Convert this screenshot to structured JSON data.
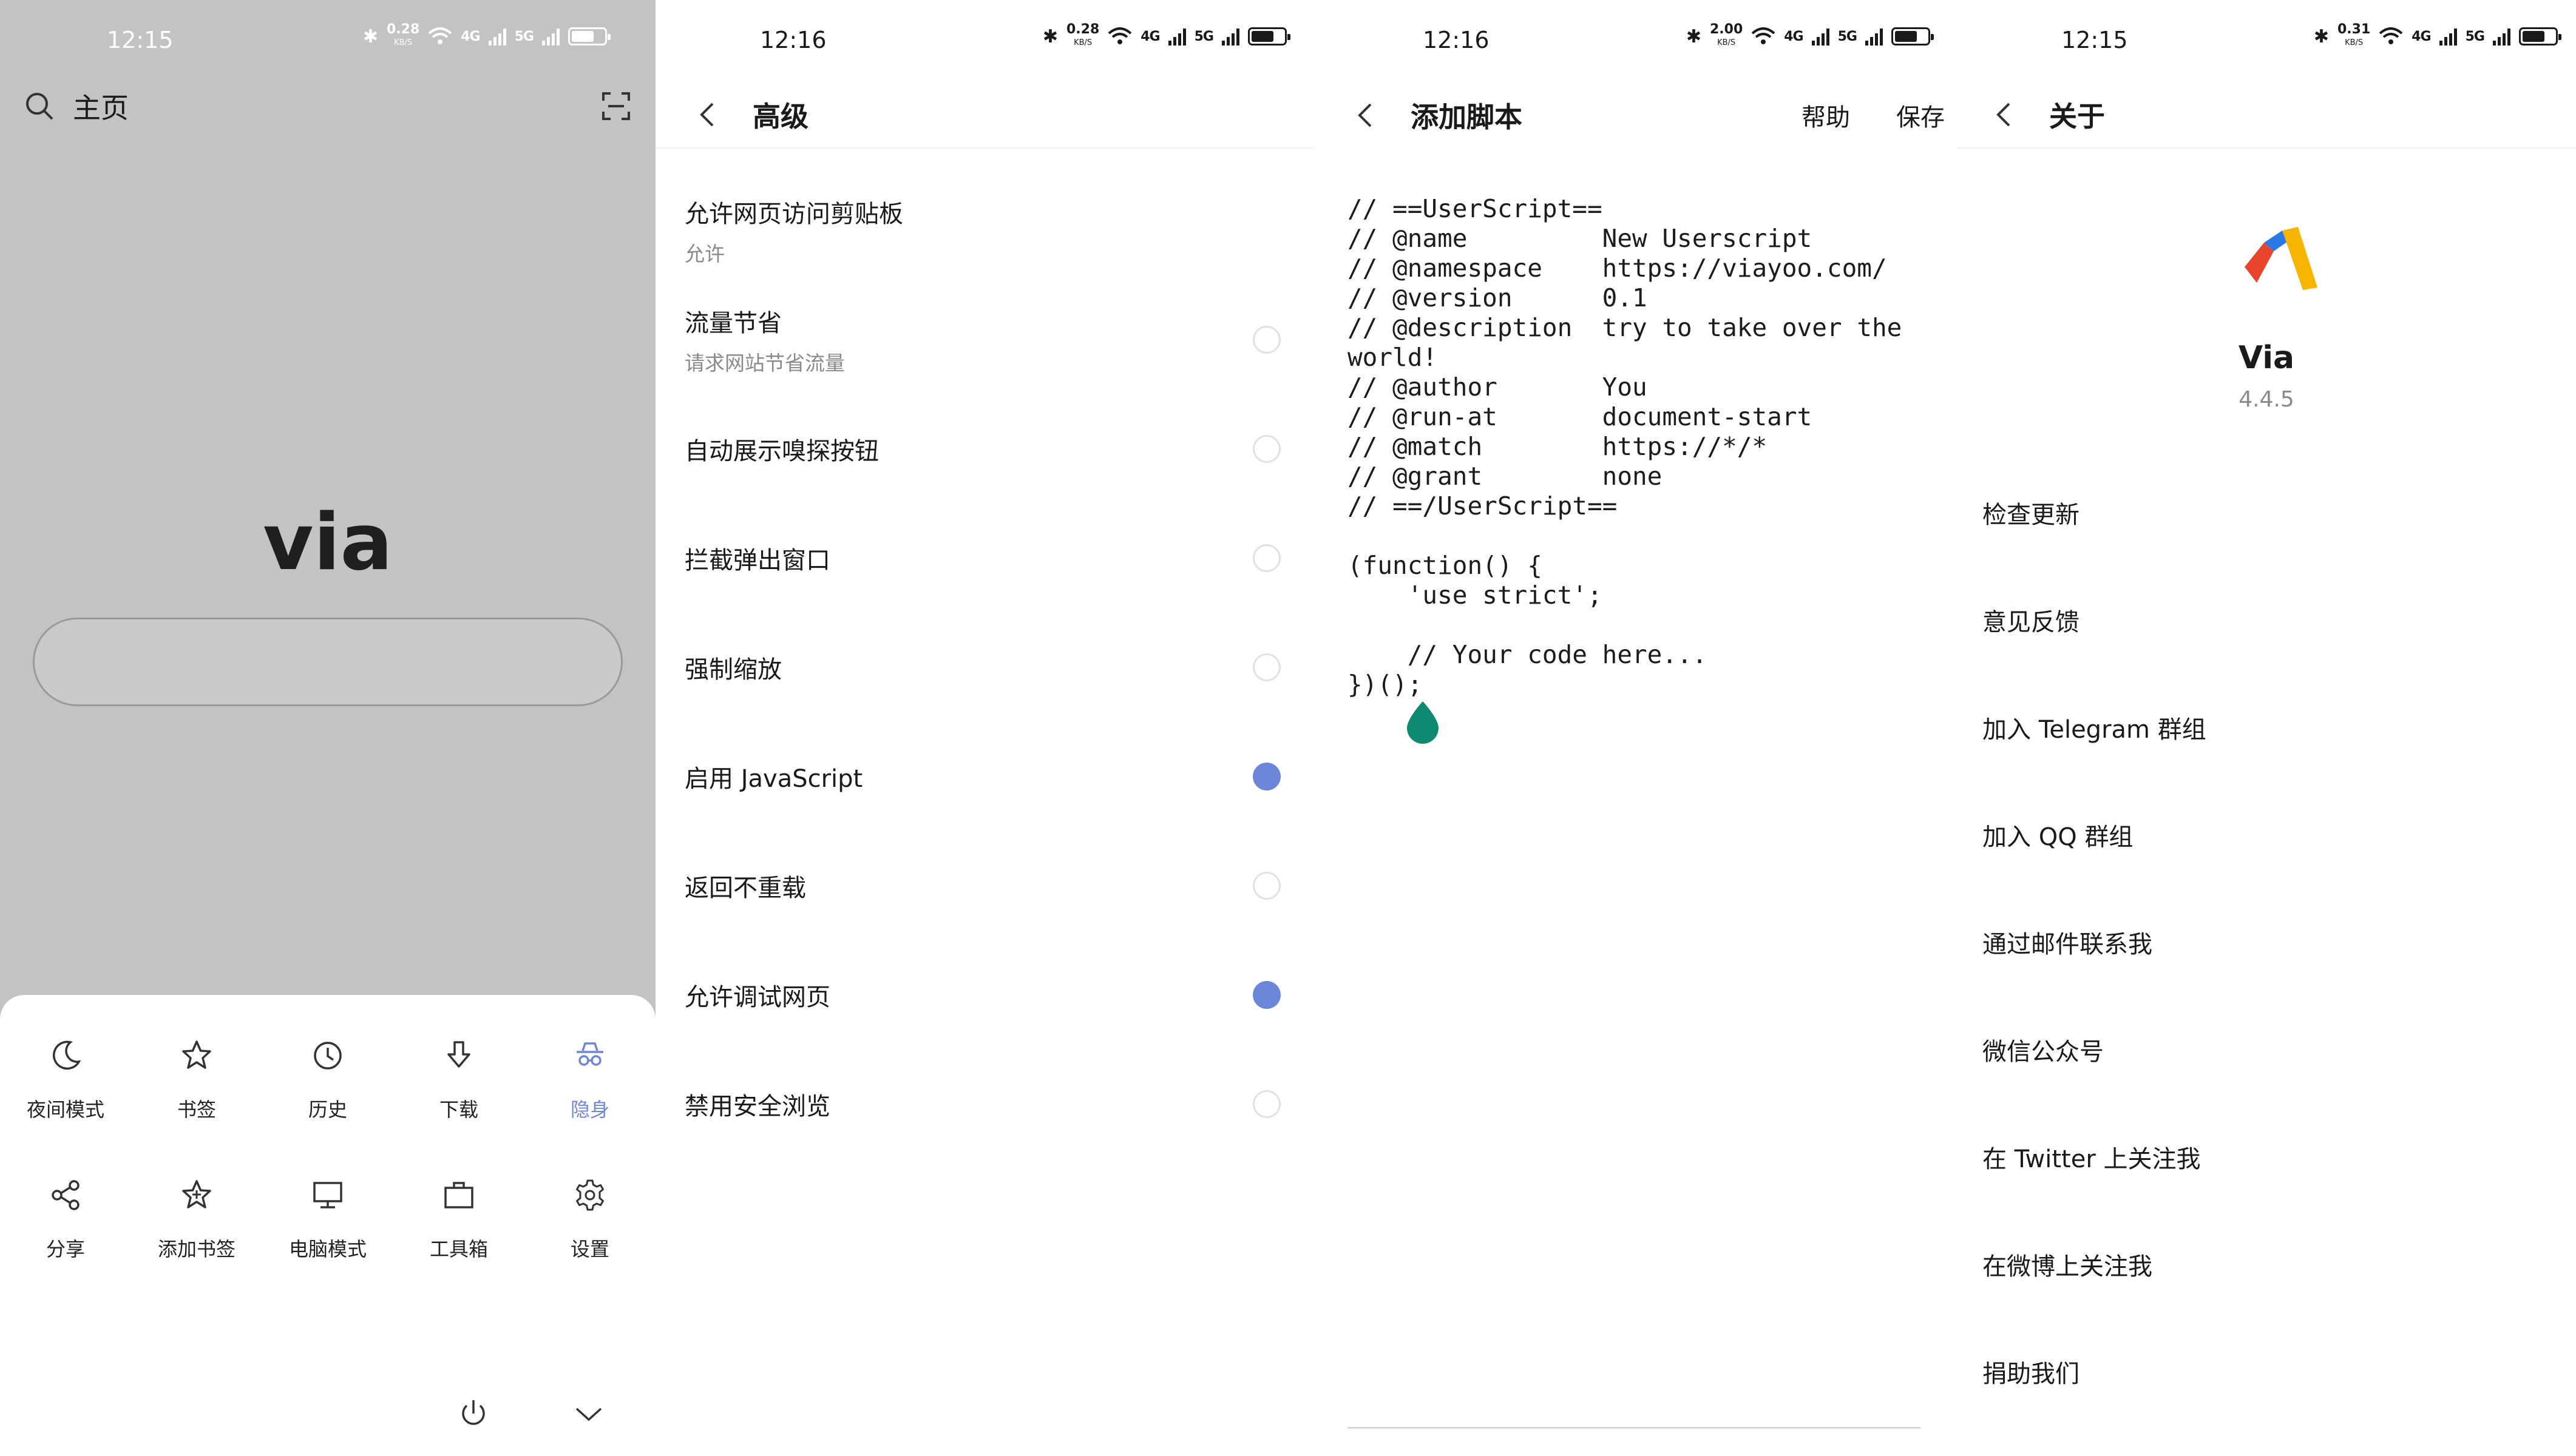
{
  "home": {
    "status": {
      "time": "12:15",
      "speed": "0.28",
      "speed_unit": "KB/S",
      "net1": "4G",
      "net2": "5G"
    },
    "title": "主页",
    "logo_text": "via",
    "menu": [
      {
        "label": "夜间模式",
        "icon": "moon-icon"
      },
      {
        "label": "书签",
        "icon": "star-icon"
      },
      {
        "label": "历史",
        "icon": "clock-icon"
      },
      {
        "label": "下载",
        "icon": "download-icon"
      },
      {
        "label": "隐身",
        "icon": "incognito-icon"
      },
      {
        "label": "分享",
        "icon": "share-icon"
      },
      {
        "label": "添加书签",
        "icon": "add-star-icon"
      },
      {
        "label": "电脑模式",
        "icon": "monitor-icon"
      },
      {
        "label": "工具箱",
        "icon": "toolbox-icon"
      },
      {
        "label": "设置",
        "icon": "gear-icon"
      }
    ],
    "active_color": "#6f87d6"
  },
  "advanced": {
    "status": {
      "time": "12:16",
      "speed": "0.28",
      "speed_unit": "KB/S",
      "net1": "4G",
      "net2": "5G"
    },
    "title": "高级",
    "items": [
      {
        "label": "允许网页访问剪贴板",
        "sub": "允许",
        "toggle": null
      },
      {
        "label": "流量节省",
        "sub": "请求网站节省流量",
        "toggle": false
      },
      {
        "label": "自动展示嗅探按钮",
        "sub": "",
        "toggle": false
      },
      {
        "label": "拦截弹出窗口",
        "sub": "",
        "toggle": false
      },
      {
        "label": "强制缩放",
        "sub": "",
        "toggle": false
      },
      {
        "label": "启用 JavaScript",
        "sub": "",
        "toggle": true
      },
      {
        "label": "返回不重载",
        "sub": "",
        "toggle": false
      },
      {
        "label": "允许调试网页",
        "sub": "",
        "toggle": true
      },
      {
        "label": "禁用安全浏览",
        "sub": "",
        "toggle": false
      }
    ],
    "radio_on_color": "#6c86da"
  },
  "script": {
    "status": {
      "time": "12:16",
      "speed": "2.00",
      "speed_unit": "KB/S",
      "net1": "4G",
      "net2": "5G"
    },
    "title": "添加脚本",
    "help_label": "帮助",
    "save_label": "保存",
    "code": "// ==UserScript==\n// @name         New Userscript\n// @namespace    https://viayoo.com/\n// @version      0.1\n// @description  try to take over the\nworld!\n// @author       You\n// @run-at       document-start\n// @match        https://*/*\n// @grant        none\n// ==/UserScript==\n\n(function() {\n    'use strict';\n\n    // Your code here...\n})();",
    "cursor_color": "#0f8a72"
  },
  "about": {
    "status": {
      "time": "12:15",
      "speed": "0.31",
      "speed_unit": "KB/S",
      "net1": "4G",
      "net2": "5G"
    },
    "title": "关于",
    "app_name": "Via",
    "version": "4.4.5",
    "items": [
      "检查更新",
      "意见反馈",
      "加入 Telegram 群组",
      "加入 QQ 群组",
      "通过邮件联系我",
      "微信公众号",
      "在 Twitter 上关注我",
      "在微博上关注我",
      "捐助我们"
    ]
  }
}
